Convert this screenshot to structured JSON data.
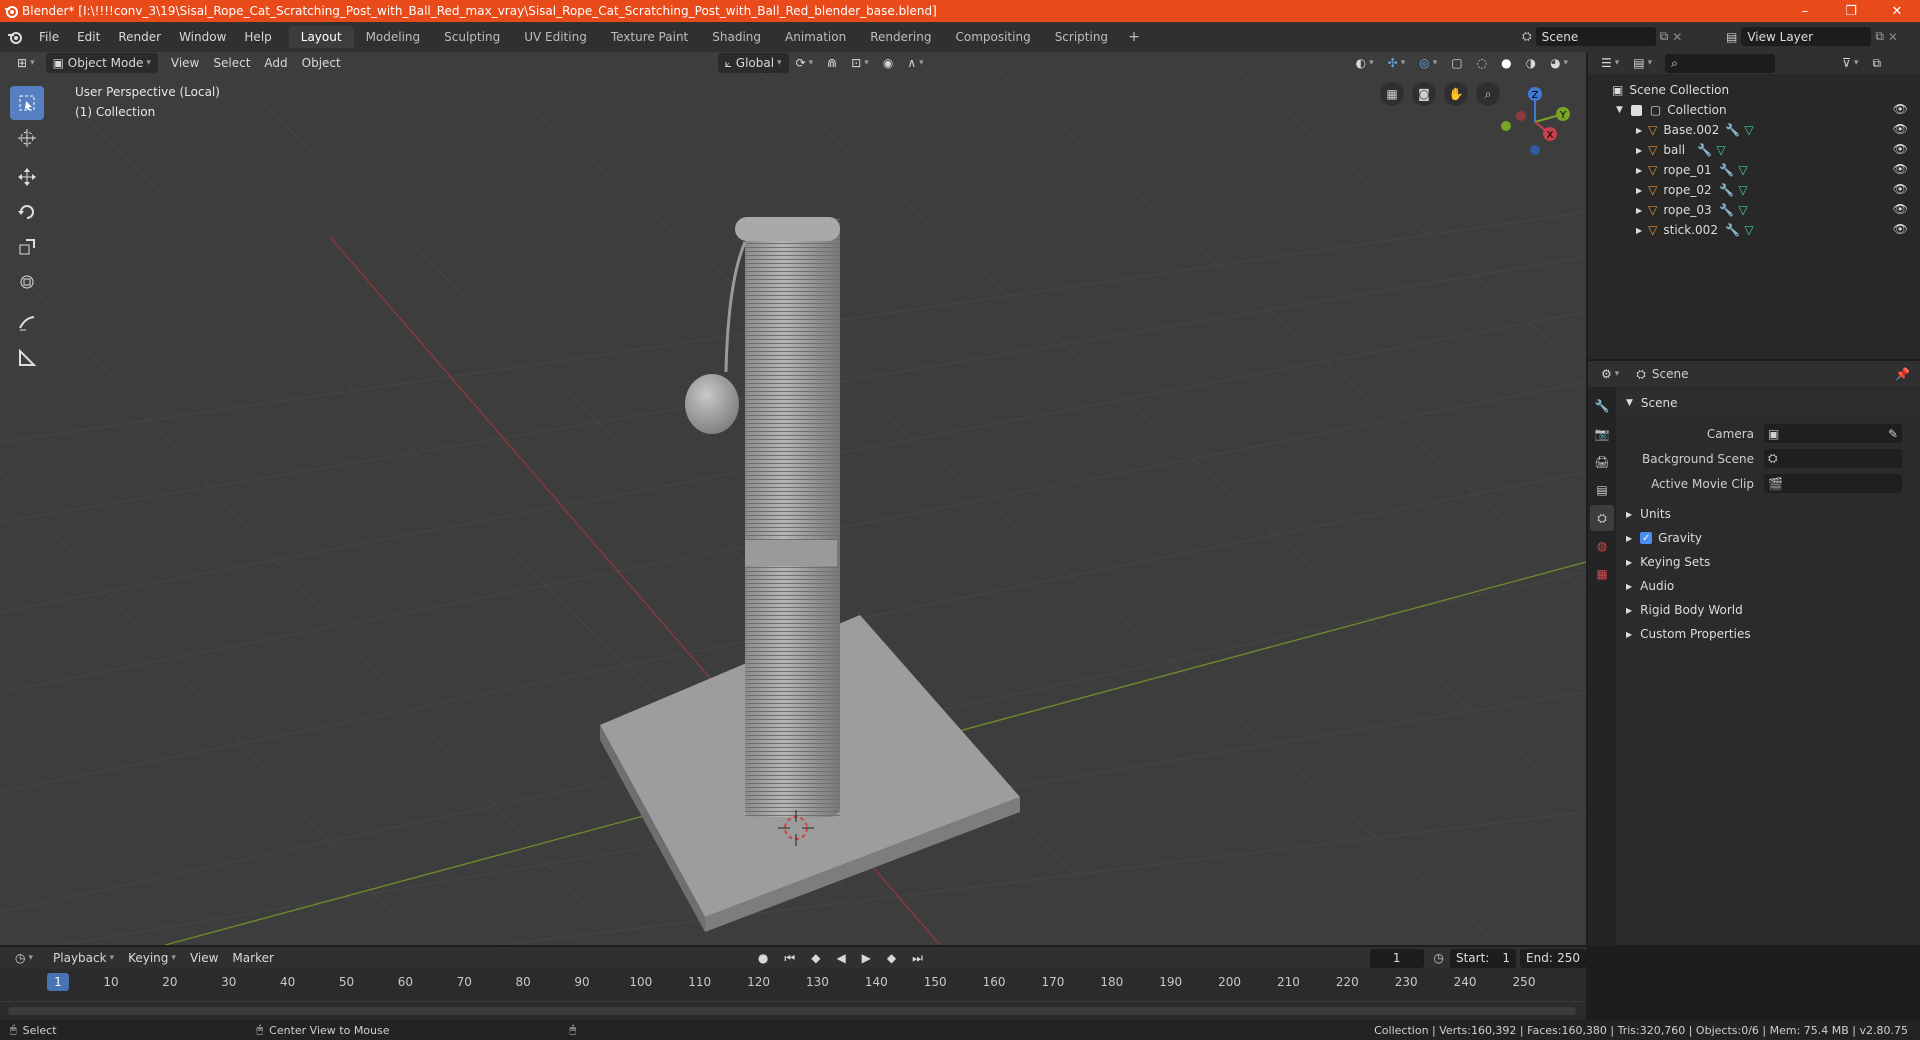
{
  "window": {
    "title": "Blender* [I:\\!!!!conv_3\\19\\Sisal_Rope_Cat_Scratching_Post_with_Ball_Red_max_vray\\Sisal_Rope_Cat_Scratching_Post_with_Ball_Red_blender_base.blend]",
    "minimize": "–",
    "maximize": "❐",
    "close": "✕"
  },
  "menu": [
    "File",
    "Edit",
    "Render",
    "Window",
    "Help"
  ],
  "workspaces": [
    "Layout",
    "Modeling",
    "Sculpting",
    "UV Editing",
    "Texture Paint",
    "Shading",
    "Animation",
    "Rendering",
    "Compositing",
    "Scripting"
  ],
  "active_workspace": "Layout",
  "scene_selector": {
    "scene": "Scene",
    "view_layer": "View Layer"
  },
  "viewport": {
    "mode": "Object Mode",
    "menus": [
      "View",
      "Select",
      "Add",
      "Object"
    ],
    "transform_orientation": "Global",
    "info_line1": "User Perspective (Local)",
    "info_line2": "(1) Collection"
  },
  "gizmo": {
    "z": "Z",
    "y": "Y",
    "x": "X"
  },
  "outliner": {
    "root": "Scene Collection",
    "collection": "Collection",
    "objects": [
      "Base.002",
      "ball",
      "rope_01",
      "rope_02",
      "rope_03",
      "stick.002"
    ]
  },
  "properties": {
    "header": "Scene",
    "panel": "Scene",
    "camera_label": "Camera",
    "background_scene_label": "Background Scene",
    "movie_clip_label": "Active Movie Clip",
    "subpanels": [
      "Units",
      "Gravity",
      "Keying Sets",
      "Audio",
      "Rigid Body World",
      "Custom Properties"
    ],
    "gravity_checked": true
  },
  "timeline": {
    "menus": [
      "Playback",
      "Keying",
      "View",
      "Marker"
    ],
    "current_frame": "1",
    "start_label": "Start:",
    "start": "1",
    "end_label": "End:",
    "end": "250",
    "ticks": [
      "1",
      "10",
      "20",
      "30",
      "40",
      "50",
      "60",
      "70",
      "80",
      "90",
      "100",
      "110",
      "120",
      "130",
      "140",
      "150",
      "160",
      "170",
      "180",
      "190",
      "200",
      "210",
      "220",
      "230",
      "240",
      "250"
    ]
  },
  "status": {
    "select": "Select",
    "center_view": "Center View to Mouse",
    "stats": "Collection | Verts:160,392 | Faces:160,380 | Tris:320,760 | Objects:0/6 | Mem: 75.4 MB | v2.80.75"
  },
  "colors": {
    "titlebar": "#e84a1a",
    "active_tool": "#5680c2",
    "object_icon": "#e8953a",
    "modifier_icon": "#6aa5e6",
    "mesh_icon": "#3fd0b0",
    "x_axis": "#c7414b",
    "y_axis": "#79a428",
    "z_axis": "#3d7bd6"
  }
}
